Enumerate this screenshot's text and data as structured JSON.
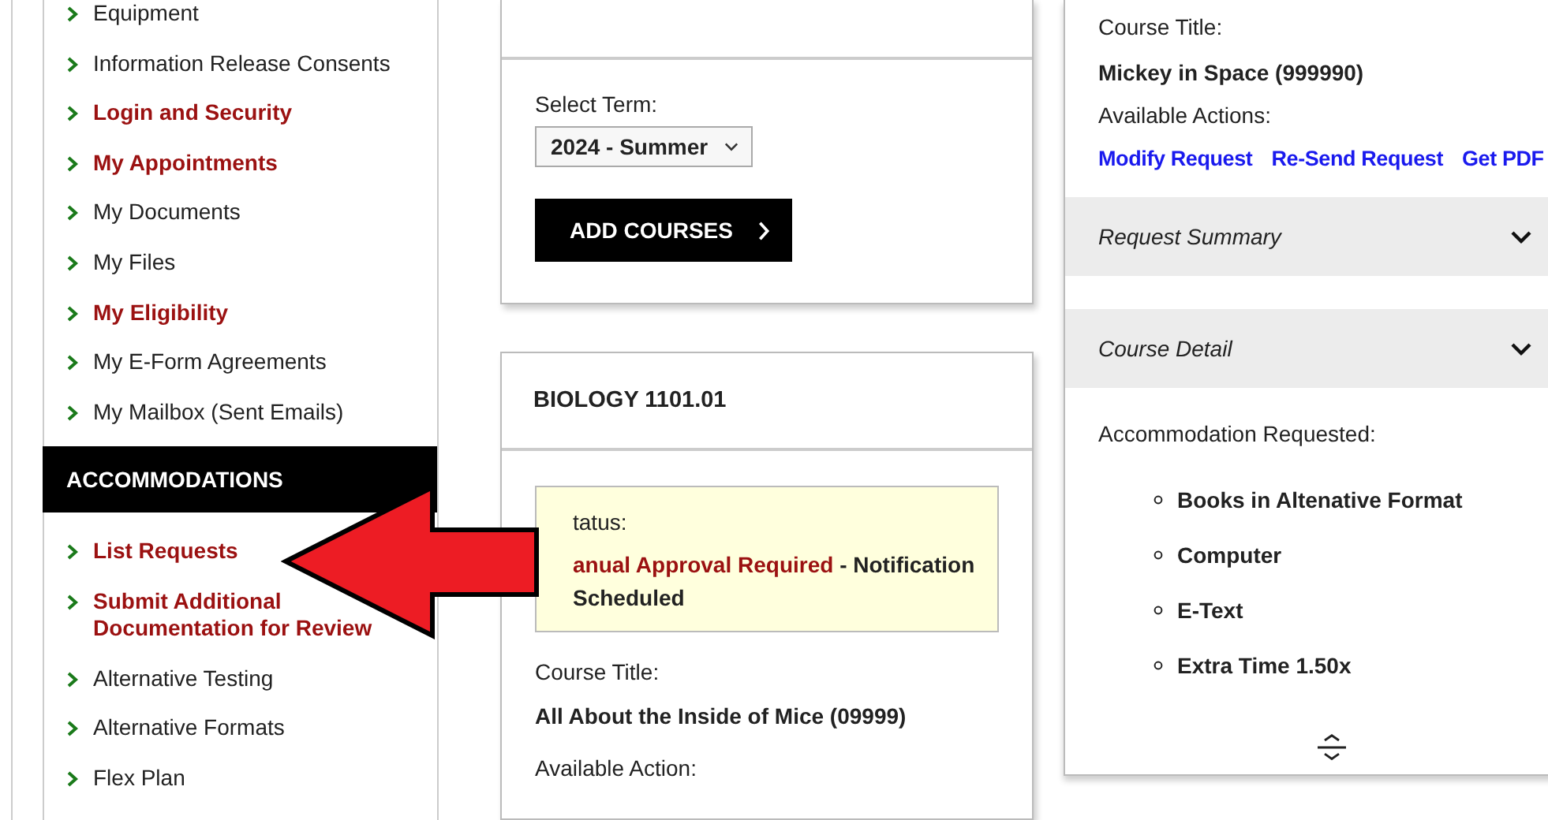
{
  "sidebar": {
    "items": [
      {
        "label": "Equipment",
        "emphasized": false
      },
      {
        "label": "Information Release Consents",
        "emphasized": false
      },
      {
        "label": "Login and Security",
        "emphasized": true
      },
      {
        "label": "My Appointments",
        "emphasized": true
      },
      {
        "label": "My Documents",
        "emphasized": false
      },
      {
        "label": "My Files",
        "emphasized": false
      },
      {
        "label": "My Eligibility",
        "emphasized": true
      },
      {
        "label": "My E-Form Agreements",
        "emphasized": false
      },
      {
        "label": "My Mailbox (Sent Emails)",
        "emphasized": false
      }
    ],
    "section_title": "ACCOMMODATIONS",
    "section_items": [
      {
        "label": "List Requests",
        "emphasized": true
      },
      {
        "label": "Submit Additional Documentation for Review",
        "emphasized": true
      },
      {
        "label": "Alternative Testing",
        "emphasized": false
      },
      {
        "label": "Alternative Formats",
        "emphasized": false
      },
      {
        "label": "Flex Plan",
        "emphasized": false
      }
    ]
  },
  "term_card": {
    "label": "Select Term:",
    "term": "2024 - Summer",
    "button": "ADD COURSES"
  },
  "course_card": {
    "title": "BIOLOGY 1101.01",
    "status_label": "tatus:",
    "status_value": "anual Approval Required",
    "status_note": "- Notification Scheduled",
    "course_title_label": "Course Title:",
    "course_title": "All About the Inside of Mice (09999)",
    "actions_label": "Available Action:"
  },
  "detail_panel": {
    "course_title_label": "Course Title:",
    "course_title": "Mickey in Space (999990)",
    "actions_label": "Available Actions:",
    "actions": [
      "Modify Request",
      "Re-Send Request",
      "Get PDF"
    ],
    "sections": [
      {
        "label": "Request Summary",
        "expanded": false
      },
      {
        "label": "Course Detail",
        "expanded": false
      }
    ],
    "accommodations_label": "Accommodation Requested:",
    "accommodations": [
      "Books in Altenative Format",
      "Computer",
      "E-Text",
      "Extra Time 1.50x"
    ]
  }
}
